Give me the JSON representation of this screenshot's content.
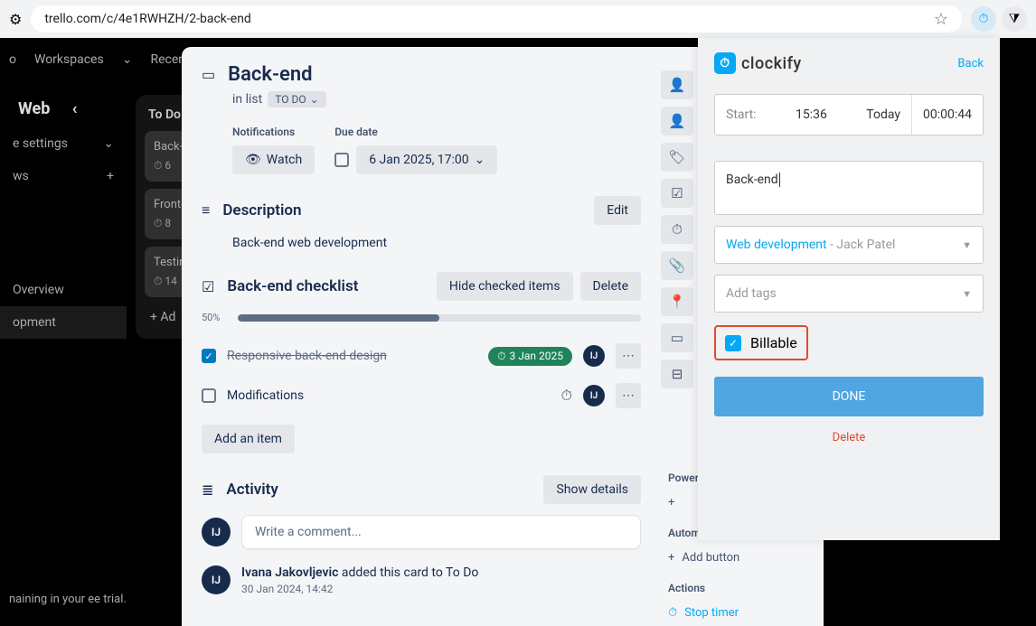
{
  "browser": {
    "url": "trello.com/c/4e1RWHZH/2-back-end"
  },
  "background": {
    "topnav": {
      "workspaces": "Workspaces",
      "recent": "Recent"
    },
    "board_title": "Web",
    "sidebar": {
      "settings": "e settings",
      "ws": "ws",
      "overview": "Overview",
      "opment": "opment"
    },
    "list": {
      "title": "To Do",
      "cards": [
        {
          "title": "Back-",
          "meta": "6"
        },
        {
          "title": "Front-",
          "meta": "8"
        },
        {
          "title": "Testin",
          "meta": "14"
        }
      ],
      "add": "Ad"
    },
    "trial": "naining in your\nee trial."
  },
  "card": {
    "title": "Back-end",
    "in_list_prefix": "in list",
    "list_name": "TO DO",
    "notifications_label": "Notifications",
    "watch_label": "Watch",
    "due_label": "Due date",
    "due_value": "6 Jan 2025, 17:00",
    "description_label": "Description",
    "edit_label": "Edit",
    "description_text": "Back-end web development",
    "checklist": {
      "title": "Back-end checklist",
      "hide_label": "Hide checked items",
      "delete_label": "Delete",
      "progress_pct": "50%",
      "progress_value": 50,
      "items": [
        {
          "text": "Responsive back-end design",
          "done": true,
          "date": "3 Jan 2025",
          "avatar": "IJ"
        },
        {
          "text": "Modifications",
          "done": false,
          "avatar": "IJ"
        }
      ],
      "add_item": "Add an item"
    },
    "activity": {
      "title": "Activity",
      "show_details": "Show details",
      "comment_placeholder": "Write a comment...",
      "entry": {
        "avatar": "IJ",
        "name": "Ivana Jakovljevic",
        "action": " added this card to To Do",
        "time": "30 Jan 2024, 14:42"
      }
    },
    "side_lower": {
      "powerup": "Power",
      "automation": "Autom",
      "add_button": "Add button",
      "actions": "Actions",
      "stop_timer": "Stop timer"
    }
  },
  "clockify": {
    "logo_text": "clockify",
    "back": "Back",
    "start_label": "Start:",
    "start_time": "15:36",
    "today": "Today",
    "elapsed": "00:00:44",
    "description": "Back-end",
    "project": "Web development",
    "client": " - Jack Patel",
    "tags_placeholder": "Add tags",
    "billable_label": "Billable",
    "done": "DONE",
    "delete": "Delete"
  }
}
